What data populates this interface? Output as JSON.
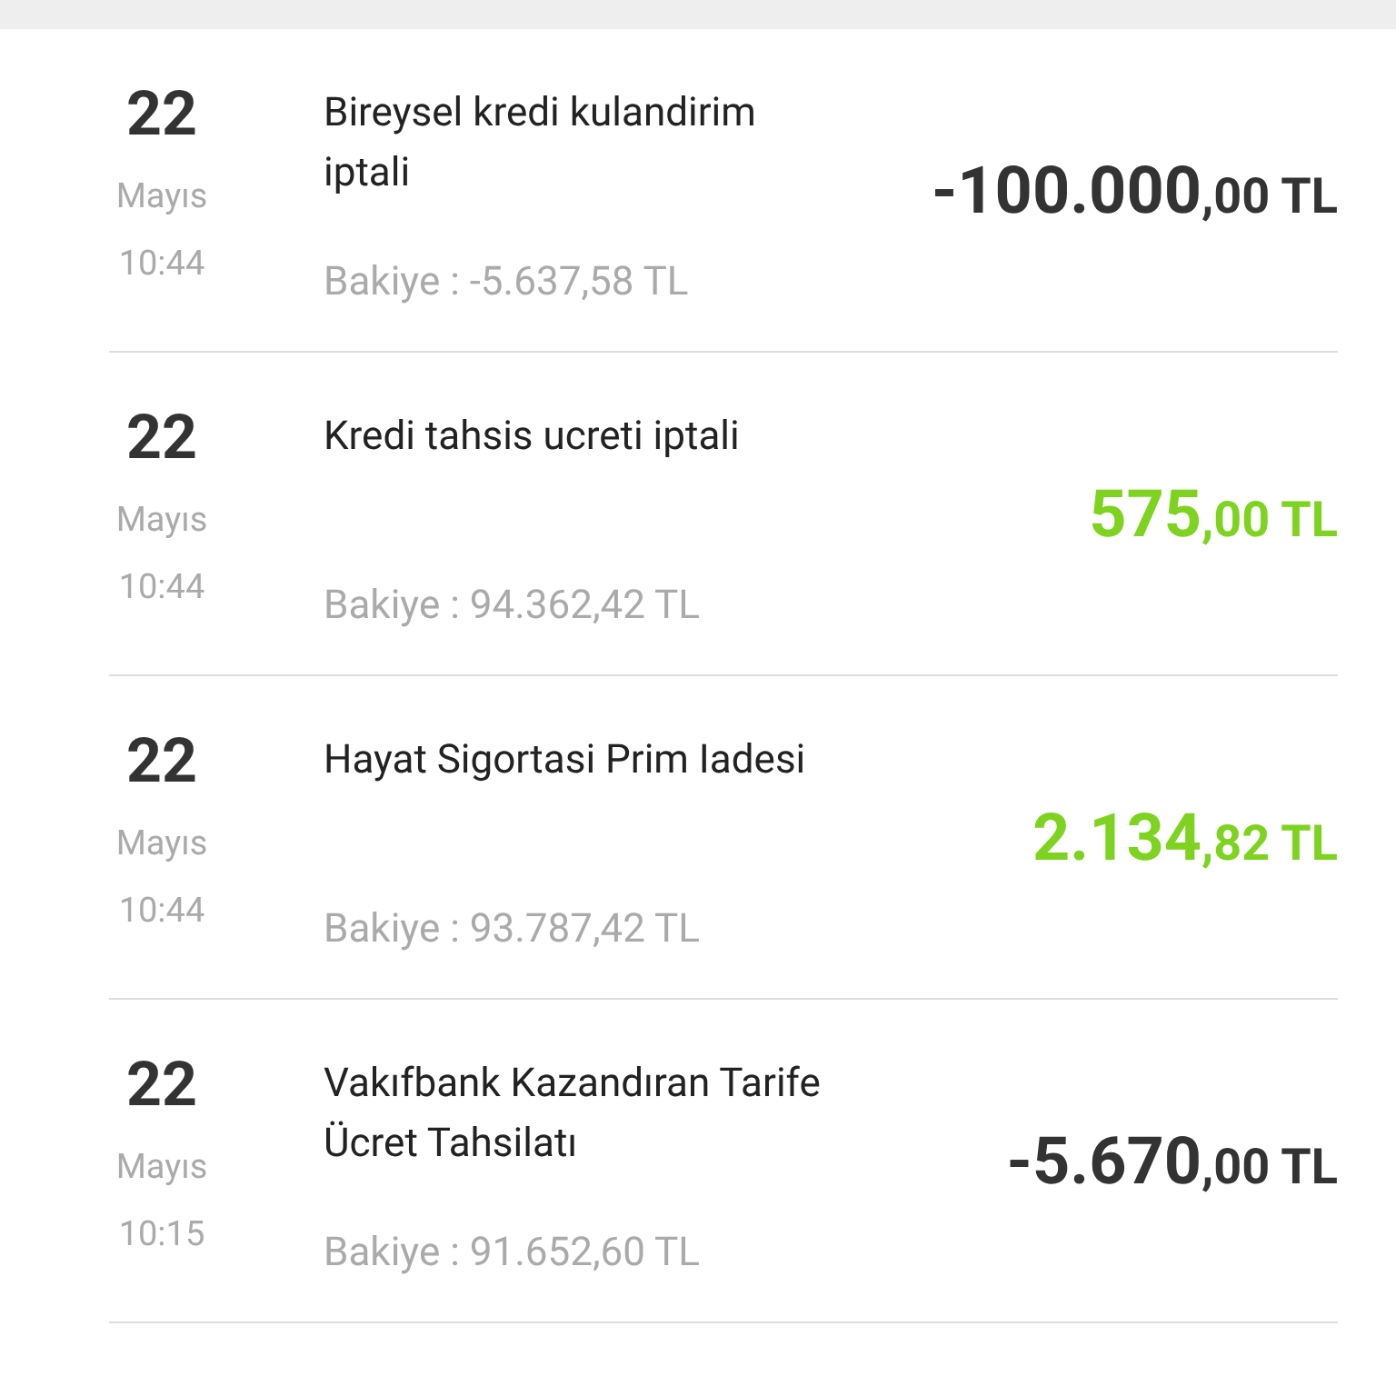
{
  "transactions": [
    {
      "day": "22",
      "month": "Mayıs",
      "time": "10:44",
      "title": "Bireysel kredi kulandirim iptali",
      "balance": "Bakiye : -5.637,58 TL",
      "amount_main": "-100.000",
      "amount_minor": ",00 TL",
      "kind": "debit"
    },
    {
      "day": "22",
      "month": "Mayıs",
      "time": "10:44",
      "title": "Kredi tahsis ucreti iptali",
      "balance": "Bakiye : 94.362,42 TL",
      "amount_main": "575",
      "amount_minor": ",00 TL",
      "kind": "credit"
    },
    {
      "day": "22",
      "month": "Mayıs",
      "time": "10:44",
      "title": "Hayat Sigortasi Prim Iadesi",
      "balance": "Bakiye : 93.787,42 TL",
      "amount_main": "2.134",
      "amount_minor": ",82 TL",
      "kind": "credit"
    },
    {
      "day": "22",
      "month": "Mayıs",
      "time": "10:15",
      "title": "Vakıfbank Kazandıran Tarife Ücret Tahsilatı",
      "balance": "Bakiye : 91.652,60 TL",
      "amount_main": "-5.670",
      "amount_minor": ",00 TL",
      "kind": "debit"
    }
  ]
}
